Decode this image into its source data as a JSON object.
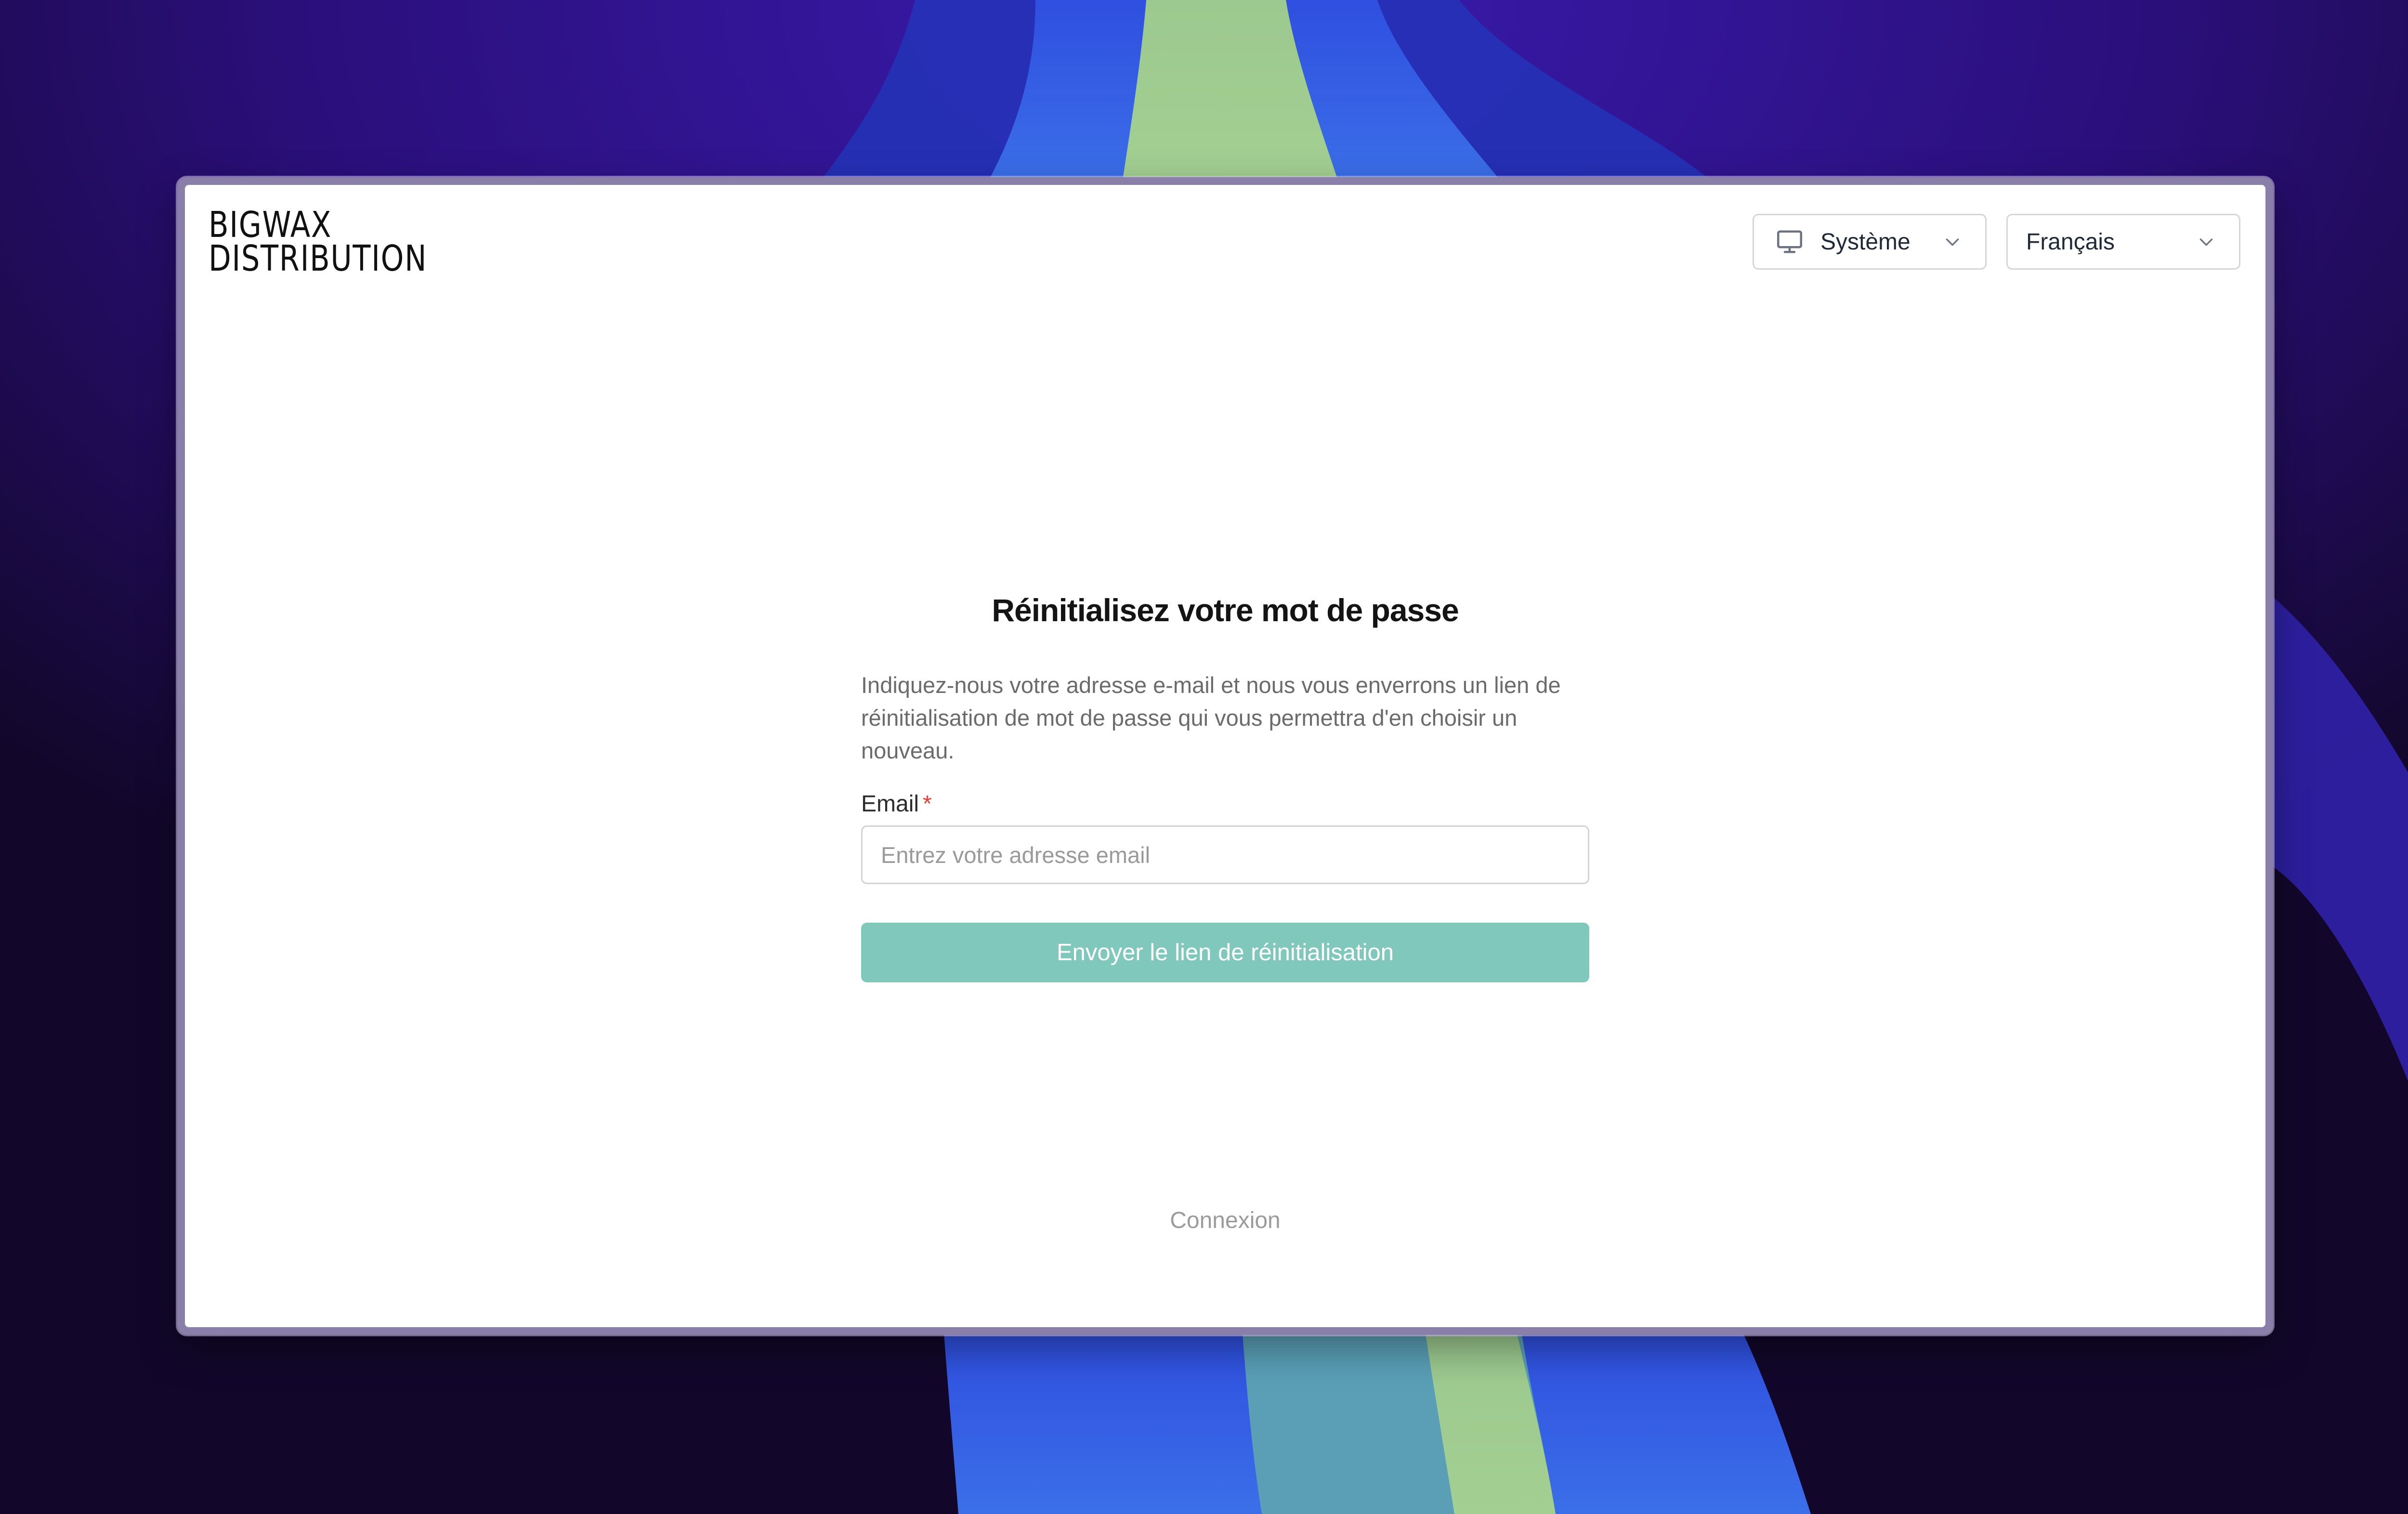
{
  "brand": {
    "line1": "BIGWAX",
    "line2": "DISTRIBUTION"
  },
  "header": {
    "theme_select": {
      "value": "Système",
      "icon": "monitor-icon"
    },
    "language_select": {
      "value": "Français"
    }
  },
  "form": {
    "title": "Réinitialisez votre mot de passe",
    "description": "Indiquez-nous votre adresse e-mail et nous vous enverrons un lien de réinitialisation de mot de passe qui vous permettra d'en choisir un nouveau.",
    "email_label": "Email",
    "required_marker": "*",
    "email_value": "",
    "email_placeholder": "Entrez votre adresse email",
    "submit_label": "Envoyer le lien de réinitialisation",
    "login_link": "Connexion"
  },
  "colors": {
    "accent": "#80c8bb",
    "required": "#e0413b",
    "muted_text": "#9b9b9b"
  }
}
